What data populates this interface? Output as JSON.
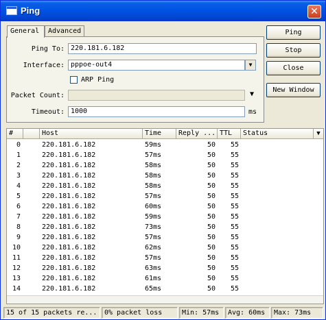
{
  "window": {
    "title": "Ping",
    "close_glyph": "✕"
  },
  "tabs": [
    {
      "label": "General"
    },
    {
      "label": "Advanced"
    }
  ],
  "form": {
    "ping_to_label": "Ping To:",
    "ping_to_value": "220.181.6.182",
    "interface_label": "Interface:",
    "interface_value": "pppoe-out4",
    "arp_ping_label": "ARP Ping",
    "arp_ping_checked": false,
    "packet_count_label": "Packet Count:",
    "packet_count_value": "",
    "timeout_label": "Timeout:",
    "timeout_value": "1000",
    "timeout_unit": "ms"
  },
  "buttons": {
    "ping": "Ping",
    "stop": "Stop",
    "close": "Close",
    "new_window": "New Window"
  },
  "table": {
    "columns": [
      "#",
      "Host",
      "Time",
      "Reply ...",
      "TTL",
      "Status"
    ],
    "rows": [
      {
        "n": "0",
        "host": "220.181.6.182",
        "time": "59ms",
        "reply": "50",
        "ttl": "55"
      },
      {
        "n": "1",
        "host": "220.181.6.182",
        "time": "57ms",
        "reply": "50",
        "ttl": "55"
      },
      {
        "n": "2",
        "host": "220.181.6.182",
        "time": "58ms",
        "reply": "50",
        "ttl": "55"
      },
      {
        "n": "3",
        "host": "220.181.6.182",
        "time": "58ms",
        "reply": "50",
        "ttl": "55"
      },
      {
        "n": "4",
        "host": "220.181.6.182",
        "time": "58ms",
        "reply": "50",
        "ttl": "55"
      },
      {
        "n": "5",
        "host": "220.181.6.182",
        "time": "57ms",
        "reply": "50",
        "ttl": "55"
      },
      {
        "n": "6",
        "host": "220.181.6.182",
        "time": "60ms",
        "reply": "50",
        "ttl": "55"
      },
      {
        "n": "7",
        "host": "220.181.6.182",
        "time": "59ms",
        "reply": "50",
        "ttl": "55"
      },
      {
        "n": "8",
        "host": "220.181.6.182",
        "time": "73ms",
        "reply": "50",
        "ttl": "55"
      },
      {
        "n": "9",
        "host": "220.181.6.182",
        "time": "57ms",
        "reply": "50",
        "ttl": "55"
      },
      {
        "n": "10",
        "host": "220.181.6.182",
        "time": "62ms",
        "reply": "50",
        "ttl": "55"
      },
      {
        "n": "11",
        "host": "220.181.6.182",
        "time": "57ms",
        "reply": "50",
        "ttl": "55"
      },
      {
        "n": "12",
        "host": "220.181.6.182",
        "time": "63ms",
        "reply": "50",
        "ttl": "55"
      },
      {
        "n": "13",
        "host": "220.181.6.182",
        "time": "61ms",
        "reply": "50",
        "ttl": "55"
      },
      {
        "n": "14",
        "host": "220.181.6.182",
        "time": "65ms",
        "reply": "50",
        "ttl": "55"
      }
    ]
  },
  "status": {
    "packets": "15 of 15 packets re...",
    "loss": "0% packet loss",
    "min": "Min: 57ms",
    "avg": "Avg: 60ms",
    "max": "Max: 73ms"
  },
  "icons": [
    "window-icon",
    "close-icon",
    "dropdown-arrow-icon",
    "column-menu-icon"
  ]
}
